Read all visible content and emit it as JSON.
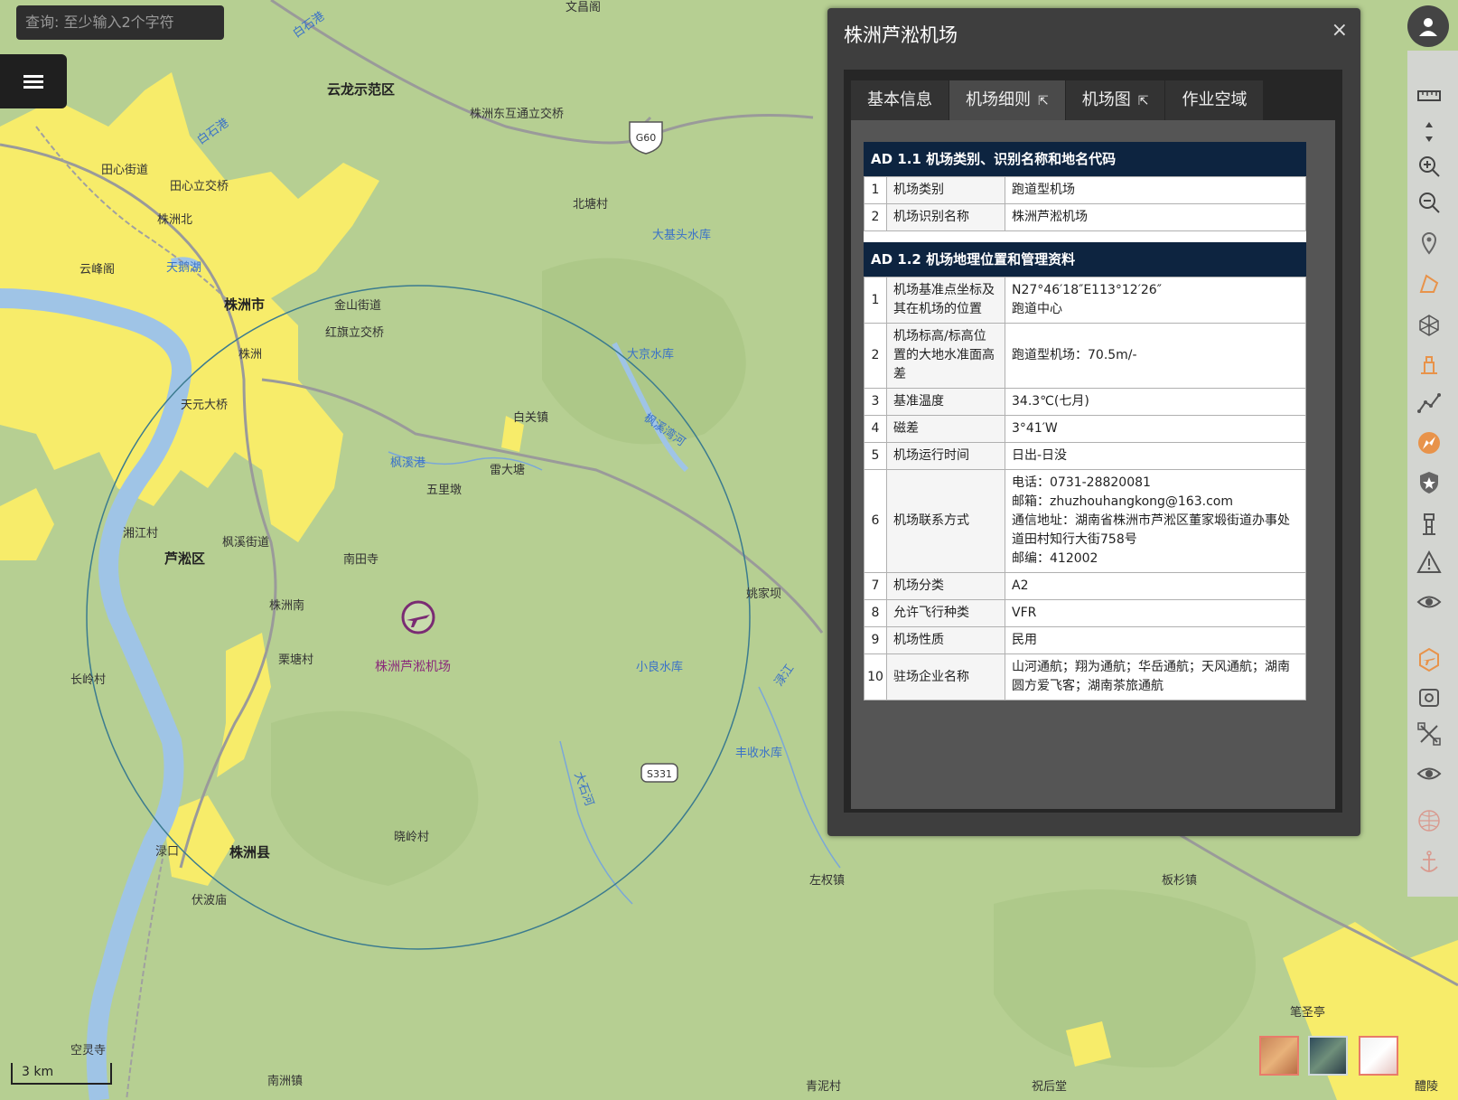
{
  "search": {
    "placeholder": "查询: 至少输入2个字符"
  },
  "map": {
    "places": [
      {
        "text": "文昌阁",
        "bold": false
      },
      {
        "text": "云龙示范区",
        "bold": true
      },
      {
        "text": "株洲东互通立交桥",
        "bold": false
      },
      {
        "text": "田心街道",
        "bold": false
      },
      {
        "text": "田心立交桥",
        "bold": false
      },
      {
        "text": "株洲北",
        "bold": false
      },
      {
        "text": "北塘村",
        "bold": false
      },
      {
        "text": "云峰阁",
        "bold": false
      },
      {
        "text": "株洲市",
        "bold": true
      },
      {
        "text": "金山街道",
        "bold": false
      },
      {
        "text": "红旗立交桥",
        "bold": false
      },
      {
        "text": "株洲",
        "bold": false
      },
      {
        "text": "天元大桥",
        "bold": false
      },
      {
        "text": "白关镇",
        "bold": false
      },
      {
        "text": "雷大塘",
        "bold": false
      },
      {
        "text": "五里墩",
        "bold": false
      },
      {
        "text": "湘江村",
        "bold": false
      },
      {
        "text": "枫溪街道",
        "bold": false
      },
      {
        "text": "芦淞区",
        "bold": true
      },
      {
        "text": "南田寺",
        "bold": false
      },
      {
        "text": "株洲南",
        "bold": false
      },
      {
        "text": "栗塘村",
        "bold": false
      },
      {
        "text": "长岭村",
        "bold": false
      },
      {
        "text": "姚家坝",
        "bold": false
      },
      {
        "text": "晓岭村",
        "bold": false
      },
      {
        "text": "渌口",
        "bold": false
      },
      {
        "text": "株洲县",
        "bold": true
      },
      {
        "text": "伏波庙",
        "bold": false
      },
      {
        "text": "左权镇",
        "bold": false
      },
      {
        "text": "板杉镇",
        "bold": false
      },
      {
        "text": "空灵寺",
        "bold": false
      },
      {
        "text": "南洲镇",
        "bold": false
      },
      {
        "text": "青泥村",
        "bold": false
      },
      {
        "text": "祝后堂",
        "bold": false
      },
      {
        "text": "笔圣亭",
        "bold": false
      },
      {
        "text": "醴陵",
        "bold": false
      }
    ],
    "water": [
      "白石港",
      "白石港",
      "天鹅湖",
      "大基头水库",
      "大京水库",
      "枫溪港",
      "枫溪湾河",
      "小良水库",
      "丰收水库",
      "大石河",
      "渌江"
    ],
    "roads": [
      "G60",
      "S331"
    ],
    "airport_label": "株洲芦淞机场",
    "scale_label": "3 km"
  },
  "panel": {
    "title": "株洲芦淞机场",
    "close": "×",
    "tabs": [
      {
        "label": "基本信息",
        "ext": ""
      },
      {
        "label": "机场细则",
        "ext": "⇱"
      },
      {
        "label": "机场图",
        "ext": "⇱"
      },
      {
        "label": "作业空域",
        "ext": ""
      }
    ],
    "sections": [
      {
        "title": "AD 1.1 机场类别、识别名称和地名代码",
        "rows": [
          {
            "n": "1",
            "k": "机场类别",
            "v": "跑道型机场"
          },
          {
            "n": "2",
            "k": "机场识别名称",
            "v": "株洲芦淞机场"
          }
        ]
      },
      {
        "title": "AD 1.2 机场地理位置和管理资料",
        "rows": [
          {
            "n": "1",
            "k": "机场基准点坐标及其在机场的位置",
            "v": "N27°46′18″E113°12′26″\n跑道中心"
          },
          {
            "n": "2",
            "k": "机场标高/标高位置的大地水准面高差",
            "v": "跑道型机场：70.5m/-"
          },
          {
            "n": "3",
            "k": "基准温度",
            "v": "34.3℃(七月)"
          },
          {
            "n": "4",
            "k": "磁差",
            "v": "3°41′W"
          },
          {
            "n": "5",
            "k": "机场运行时间",
            "v": "日出-日没"
          },
          {
            "n": "6",
            "k": "机场联系方式",
            "v": "电话：0731-28820081\n邮箱：zhuzhouhangkong@163.com\n通信地址：湖南省株洲市芦淞区董家塅街道办事处道田村知行大街758号\n邮编：412002"
          },
          {
            "n": "7",
            "k": "机场分类",
            "v": "A2"
          },
          {
            "n": "8",
            "k": "允许飞行种类",
            "v": "VFR"
          },
          {
            "n": "9",
            "k": "机场性质",
            "v": "民用"
          },
          {
            "n": "10",
            "k": "驻场企业名称",
            "v": "山河通航；翔为通航；华岳通航；天风通航；湖南圆方爱飞客；湖南茶旅通航"
          }
        ]
      }
    ]
  },
  "toolbar": {
    "tools": [
      "user-icon",
      "ruler-icon",
      "pan-arrows-icon",
      "zoom-in-icon",
      "zoom-out-icon",
      "location-pin-icon",
      "polygon-icon",
      "hexagon-icon",
      "airport-facility-icon",
      "route-line-icon",
      "compass-icon",
      "shield-star-icon",
      "tower-icon",
      "warning-icon",
      "eye-icon",
      "airport-icon",
      "camera-icon",
      "satellite-icon",
      "eye-icon-2",
      "globe-icon",
      "anchor-icon"
    ]
  },
  "colors": {
    "map_bg": "#b6cf92",
    "urban": "#f7ec6a",
    "water": "#9fc4e6",
    "panel_bg": "#3e3e3e",
    "section_head": "#0d2440",
    "airport": "#7a2b73"
  }
}
